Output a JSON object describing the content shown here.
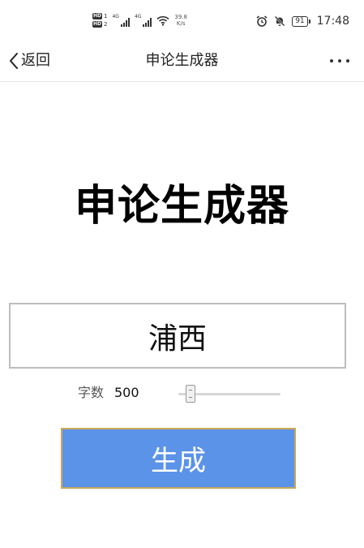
{
  "status_bar": {
    "speed_value": "39.8",
    "speed_unit": "K/s",
    "battery": "91",
    "time": "17:48",
    "signal1_label": "4G",
    "signal2_label": "4G",
    "hd1_num": "1",
    "hd2_num": "2",
    "hd_label": "HD"
  },
  "nav": {
    "back_label": "返回",
    "title": "申论生成器"
  },
  "main": {
    "headline": "申论生成器",
    "topic_value": "浦西",
    "word_count_label": "字数",
    "word_count_value": "500",
    "slider_level": 0.08,
    "generate_label": "生成"
  },
  "colors": {
    "button_bg": "#5b93e8",
    "button_border": "#c9a85a"
  }
}
